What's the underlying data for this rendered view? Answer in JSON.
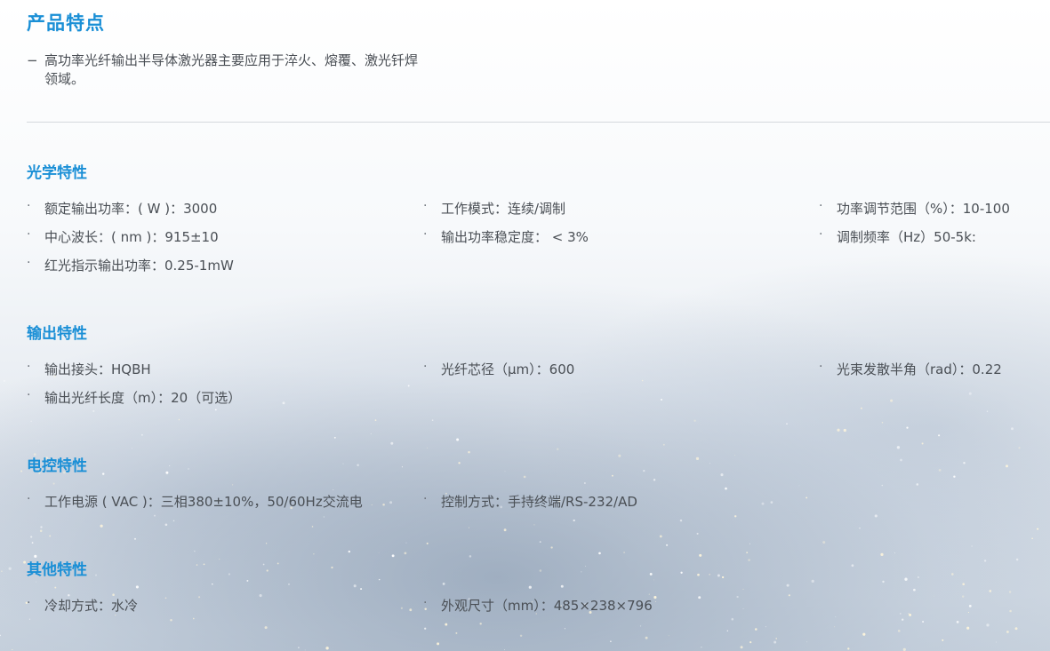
{
  "header": {
    "title": "产品特点",
    "intro_dash": "−",
    "intro": "高功率光纤输出半导体激光器主要应用于淬火、熔覆、激光钎焊领域。"
  },
  "sections": [
    {
      "title": "光学特性",
      "items": [
        "额定输出功率：( W )：3000",
        "工作模式：连续/调制",
        "功率调节范围（%）：10-100",
        "中心波长：( nm )：915±10",
        "输出功率稳定度： < 3%",
        "调制频率（Hz）50-5k:",
        "红光指示输出功率：0.25-1mW"
      ]
    },
    {
      "title": "输出特性",
      "items": [
        "输出接头：HQBH",
        "光纤芯径（μm）：600",
        "光束发散半角（rad）：0.22",
        "输出光纤长度（m）：20（可选）"
      ]
    },
    {
      "title": "电控特性",
      "items": [
        "工作电源 ( VAC )：三相380±10%，50/60Hz交流电",
        "控制方式：手持终端/RS-232/AD"
      ]
    },
    {
      "title": "其他特性",
      "items": [
        "冷却方式：水冷",
        "外观尺寸（mm）：485×238×796"
      ]
    }
  ],
  "bullet_char": "·",
  "colors": {
    "heading": "#1a8fd6",
    "text": "#4a4f55",
    "divider": "#d5d9dd"
  }
}
